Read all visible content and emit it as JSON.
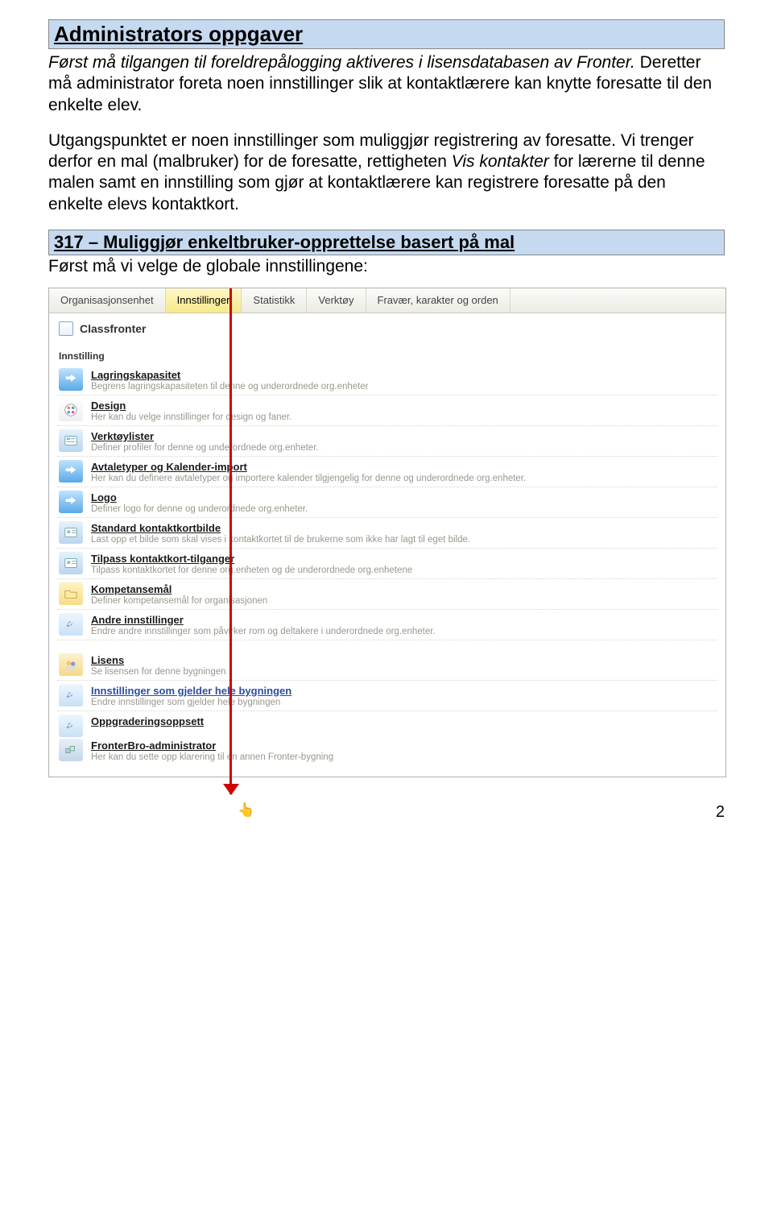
{
  "doc": {
    "h1": "Administrators oppgaver",
    "lead_prefix_italic": "Først må tilgangen til foreldrepålogging aktiveres i lisensdatabasen av Fronter.",
    "lead_rest": " Deretter må administrator foreta noen innstillinger slik at kontaktlærere kan knytte foresatte til den enkelte elev.",
    "body": "Utgangspunktet er noen innstillinger som muliggjør registrering av foresatte. Vi trenger derfor en mal (malbruker) for de foresatte, rettigheten ",
    "body_italic": "Vis kontakter",
    "body_after": " for lærerne til denne malen samt en innstilling som gjør at kontaktlærere kan registrere foresatte på den enkelte elevs kontaktkort.",
    "h2": "317 – Muliggjør enkeltbruker-opprettelse basert på mal",
    "after": "Først må vi velge de globale innstillingene:",
    "page_number": "2"
  },
  "tabs": [
    "Organisasjonsenhet",
    "Innstillinger",
    "Statistikk",
    "Verktøy",
    "Fravær, karakter og orden"
  ],
  "cf_label": "Classfronter",
  "section_innstilling": "Innstilling",
  "rows": [
    {
      "title": "Lagringskapasitet",
      "desc": "Begrens lagringskapasiteten til denne og underordnede org.enheter"
    },
    {
      "title": "Design",
      "desc": "Her kan du velge innstillinger for design og faner."
    },
    {
      "title": "Verktøylister",
      "desc": "Definer profiler for denne og underordnede org.enheter."
    },
    {
      "title": "Avtaletyper og Kalender-import",
      "desc": "Her kan du definere avtaletyper og importere kalender tilgjengelig for denne og underordnede org.enheter."
    },
    {
      "title": "Logo",
      "desc": "Definer logo for denne og underordnede org.enheter."
    },
    {
      "title": "Standard kontaktkortbilde",
      "desc": "Last opp et bilde som skal vises i kontaktkortet til de brukerne som ikke har lagt til eget bilde."
    },
    {
      "title": "Tilpass kontaktkort-tilganger",
      "desc": "Tilpass kontaktkortet for denne org.enheten og de underordnede org.enhetene"
    },
    {
      "title": "Kompetansemål",
      "desc": "Definer kompetansemål for organisasjonen"
    },
    {
      "title": "Andre innstillinger",
      "desc": "Endre andre innstillinger som påvirker rom og deltakere i underordnede org.enheter."
    }
  ],
  "rows2": [
    {
      "title": "Lisens",
      "desc": "Se lisensen for denne bygningen"
    },
    {
      "title": "Innstillinger som gjelder hele bygningen",
      "desc": "Endre innstillinger som gjelder hele bygningen",
      "link": true
    },
    {
      "title": "Oppgraderingsoppsett",
      "desc": ""
    },
    {
      "title": "FronterBro-administrator",
      "desc": "Her kan du sette opp klarering til en annen Fronter-bygning"
    }
  ]
}
